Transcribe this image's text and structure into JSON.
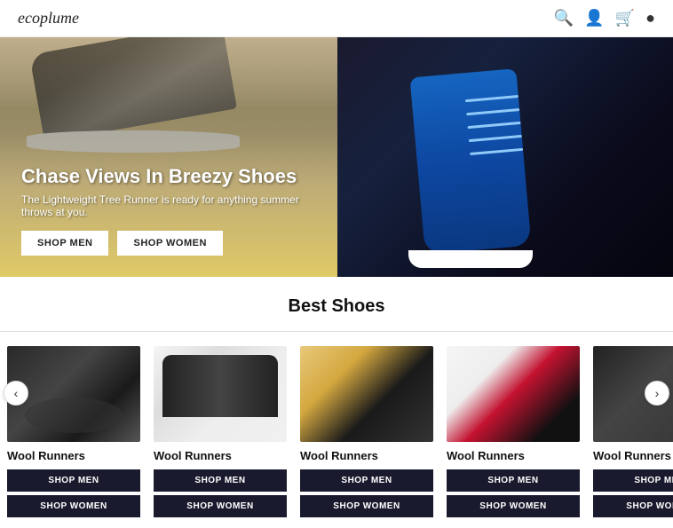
{
  "header": {
    "logo": "ecoplume",
    "icons": [
      "search",
      "user",
      "cart",
      "menu"
    ]
  },
  "hero": {
    "title": "Chase Views In Breezy Shoes",
    "subtitle": "The Lightweight Tree Runner is ready for anything summer throws at you.",
    "btn_men": "SHOP MEN",
    "btn_women": "SHOP WOMEN"
  },
  "best_shoes": {
    "section_title": "Best Shoes",
    "products": [
      {
        "name": "Wool Runners",
        "btn_men": "SHOP MEN",
        "btn_women": "SHOP WOMEN",
        "img_class": "shoe-img-1"
      },
      {
        "name": "Wool Runners",
        "btn_men": "SHOP MEN",
        "btn_women": "SHOP WOMEN",
        "img_class": "shoe-img-2"
      },
      {
        "name": "Wool Runners",
        "btn_men": "SHOP MEN",
        "btn_women": "SHOP WOMEN",
        "img_class": "shoe-img-3"
      },
      {
        "name": "Wool Runners",
        "btn_men": "SHOP MEN",
        "btn_women": "SHOP WOMEN",
        "img_class": "shoe-img-4"
      },
      {
        "name": "Wool Runners",
        "btn_men": "SHOP MEN",
        "btn_women": "SHOP WOMEN",
        "img_class": "shoe-img-5"
      }
    ]
  },
  "carousel": {
    "prev": "‹",
    "next": "›"
  }
}
